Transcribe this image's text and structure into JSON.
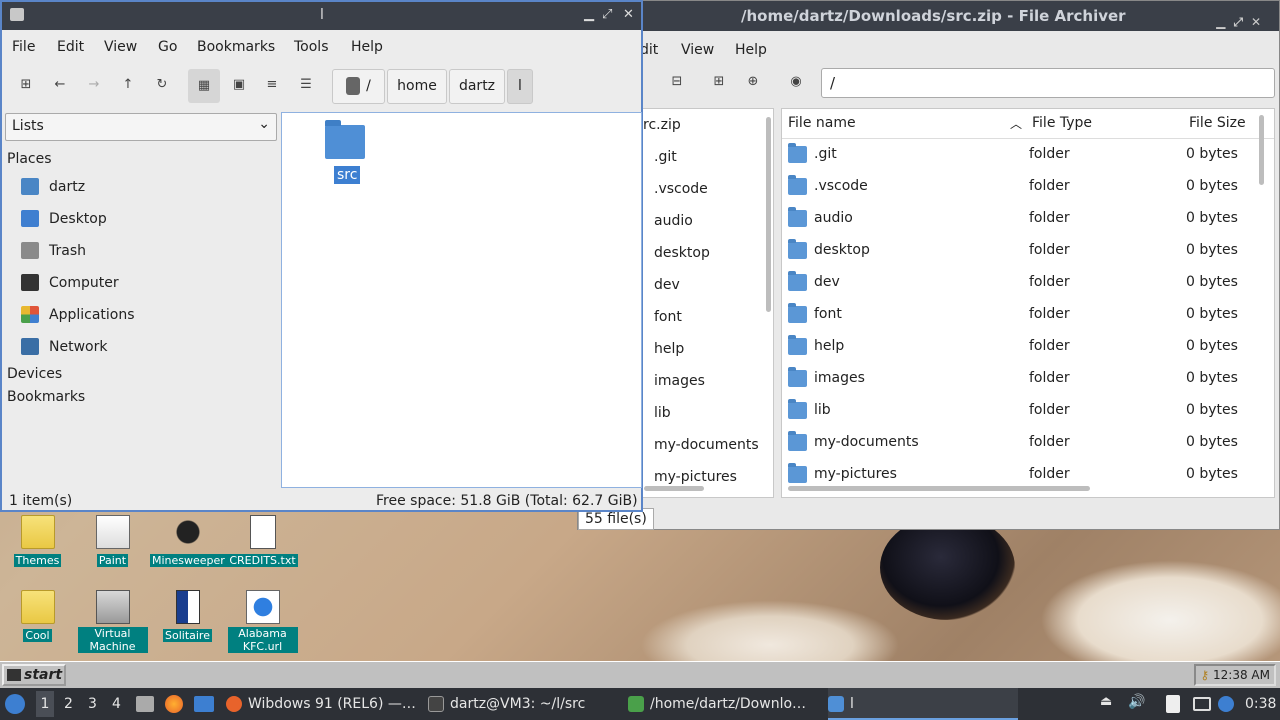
{
  "desktop": {
    "icons": [
      {
        "label": "Themes"
      },
      {
        "label": "Paint"
      },
      {
        "label": "Minesweeper"
      },
      {
        "label": "CREDITS.txt"
      },
      {
        "label": "Cool"
      },
      {
        "label": "Virtual Machine"
      },
      {
        "label": "Solitaire"
      },
      {
        "label": "Alabama KFC.url"
      }
    ]
  },
  "archiver": {
    "title": "/home/dartz/Downloads/src.zip - File Archiver",
    "menu": [
      "dit",
      "View",
      "Help"
    ],
    "location": "/",
    "tree": [
      "rc.zip",
      ".git",
      ".vscode",
      "audio",
      "desktop",
      "dev",
      "font",
      "help",
      "images",
      "lib",
      "my-documents",
      "my-pictures"
    ],
    "columns": [
      "File name",
      "File Type",
      "File Size"
    ],
    "rows": [
      {
        "name": ".git",
        "type": "folder",
        "size": "0 bytes"
      },
      {
        "name": ".vscode",
        "type": "folder",
        "size": "0 bytes"
      },
      {
        "name": "audio",
        "type": "folder",
        "size": "0 bytes"
      },
      {
        "name": "desktop",
        "type": "folder",
        "size": "0 bytes"
      },
      {
        "name": "dev",
        "type": "folder",
        "size": "0 bytes"
      },
      {
        "name": "font",
        "type": "folder",
        "size": "0 bytes"
      },
      {
        "name": "help",
        "type": "folder",
        "size": "0 bytes"
      },
      {
        "name": "images",
        "type": "folder",
        "size": "0 bytes"
      },
      {
        "name": "lib",
        "type": "folder",
        "size": "0 bytes"
      },
      {
        "name": "my-documents",
        "type": "folder",
        "size": "0 bytes"
      },
      {
        "name": "my-pictures",
        "type": "folder",
        "size": "0 bytes"
      }
    ],
    "status": "55 file(s)"
  },
  "filemanager": {
    "title": "l",
    "menu": [
      "File",
      "Edit",
      "View",
      "Go",
      "Bookmarks",
      "Tools",
      "Help"
    ],
    "path": [
      "/",
      "home",
      "dartz",
      "l"
    ],
    "side_select": "Lists",
    "sections": {
      "places": "Places",
      "devices": "Devices",
      "bookmarks": "Bookmarks"
    },
    "places": [
      {
        "label": "dartz",
        "color": "#4a86c5"
      },
      {
        "label": "Desktop",
        "color": "#3f7fd0"
      },
      {
        "label": "Trash",
        "color": "#8a8a8a"
      },
      {
        "label": "Computer",
        "color": "#333333"
      },
      {
        "label": "Applications",
        "color": "#e0553a"
      },
      {
        "label": "Network",
        "color": "#3a6ea5"
      }
    ],
    "items": [
      {
        "label": "src"
      }
    ],
    "status_left": "1 item(s)",
    "status_right": "Free space: 51.8 GiB (Total: 62.7 GiB)"
  },
  "win_taskbar": {
    "start": "start",
    "clock": "12:38 AM"
  },
  "panel": {
    "workspaces": [
      "1",
      "2",
      "3",
      "4"
    ],
    "tasks": [
      {
        "label": "Wibdows 91 (REL6) —…",
        "color": "#e8632b"
      },
      {
        "label": "dartz@VM3: ~/l/src",
        "color": "#444444"
      },
      {
        "label": "/home/dartz/Downlo…",
        "color": "#4aa04a"
      },
      {
        "label": "l",
        "color": "#4f8fd6"
      }
    ],
    "time": "0:38"
  }
}
